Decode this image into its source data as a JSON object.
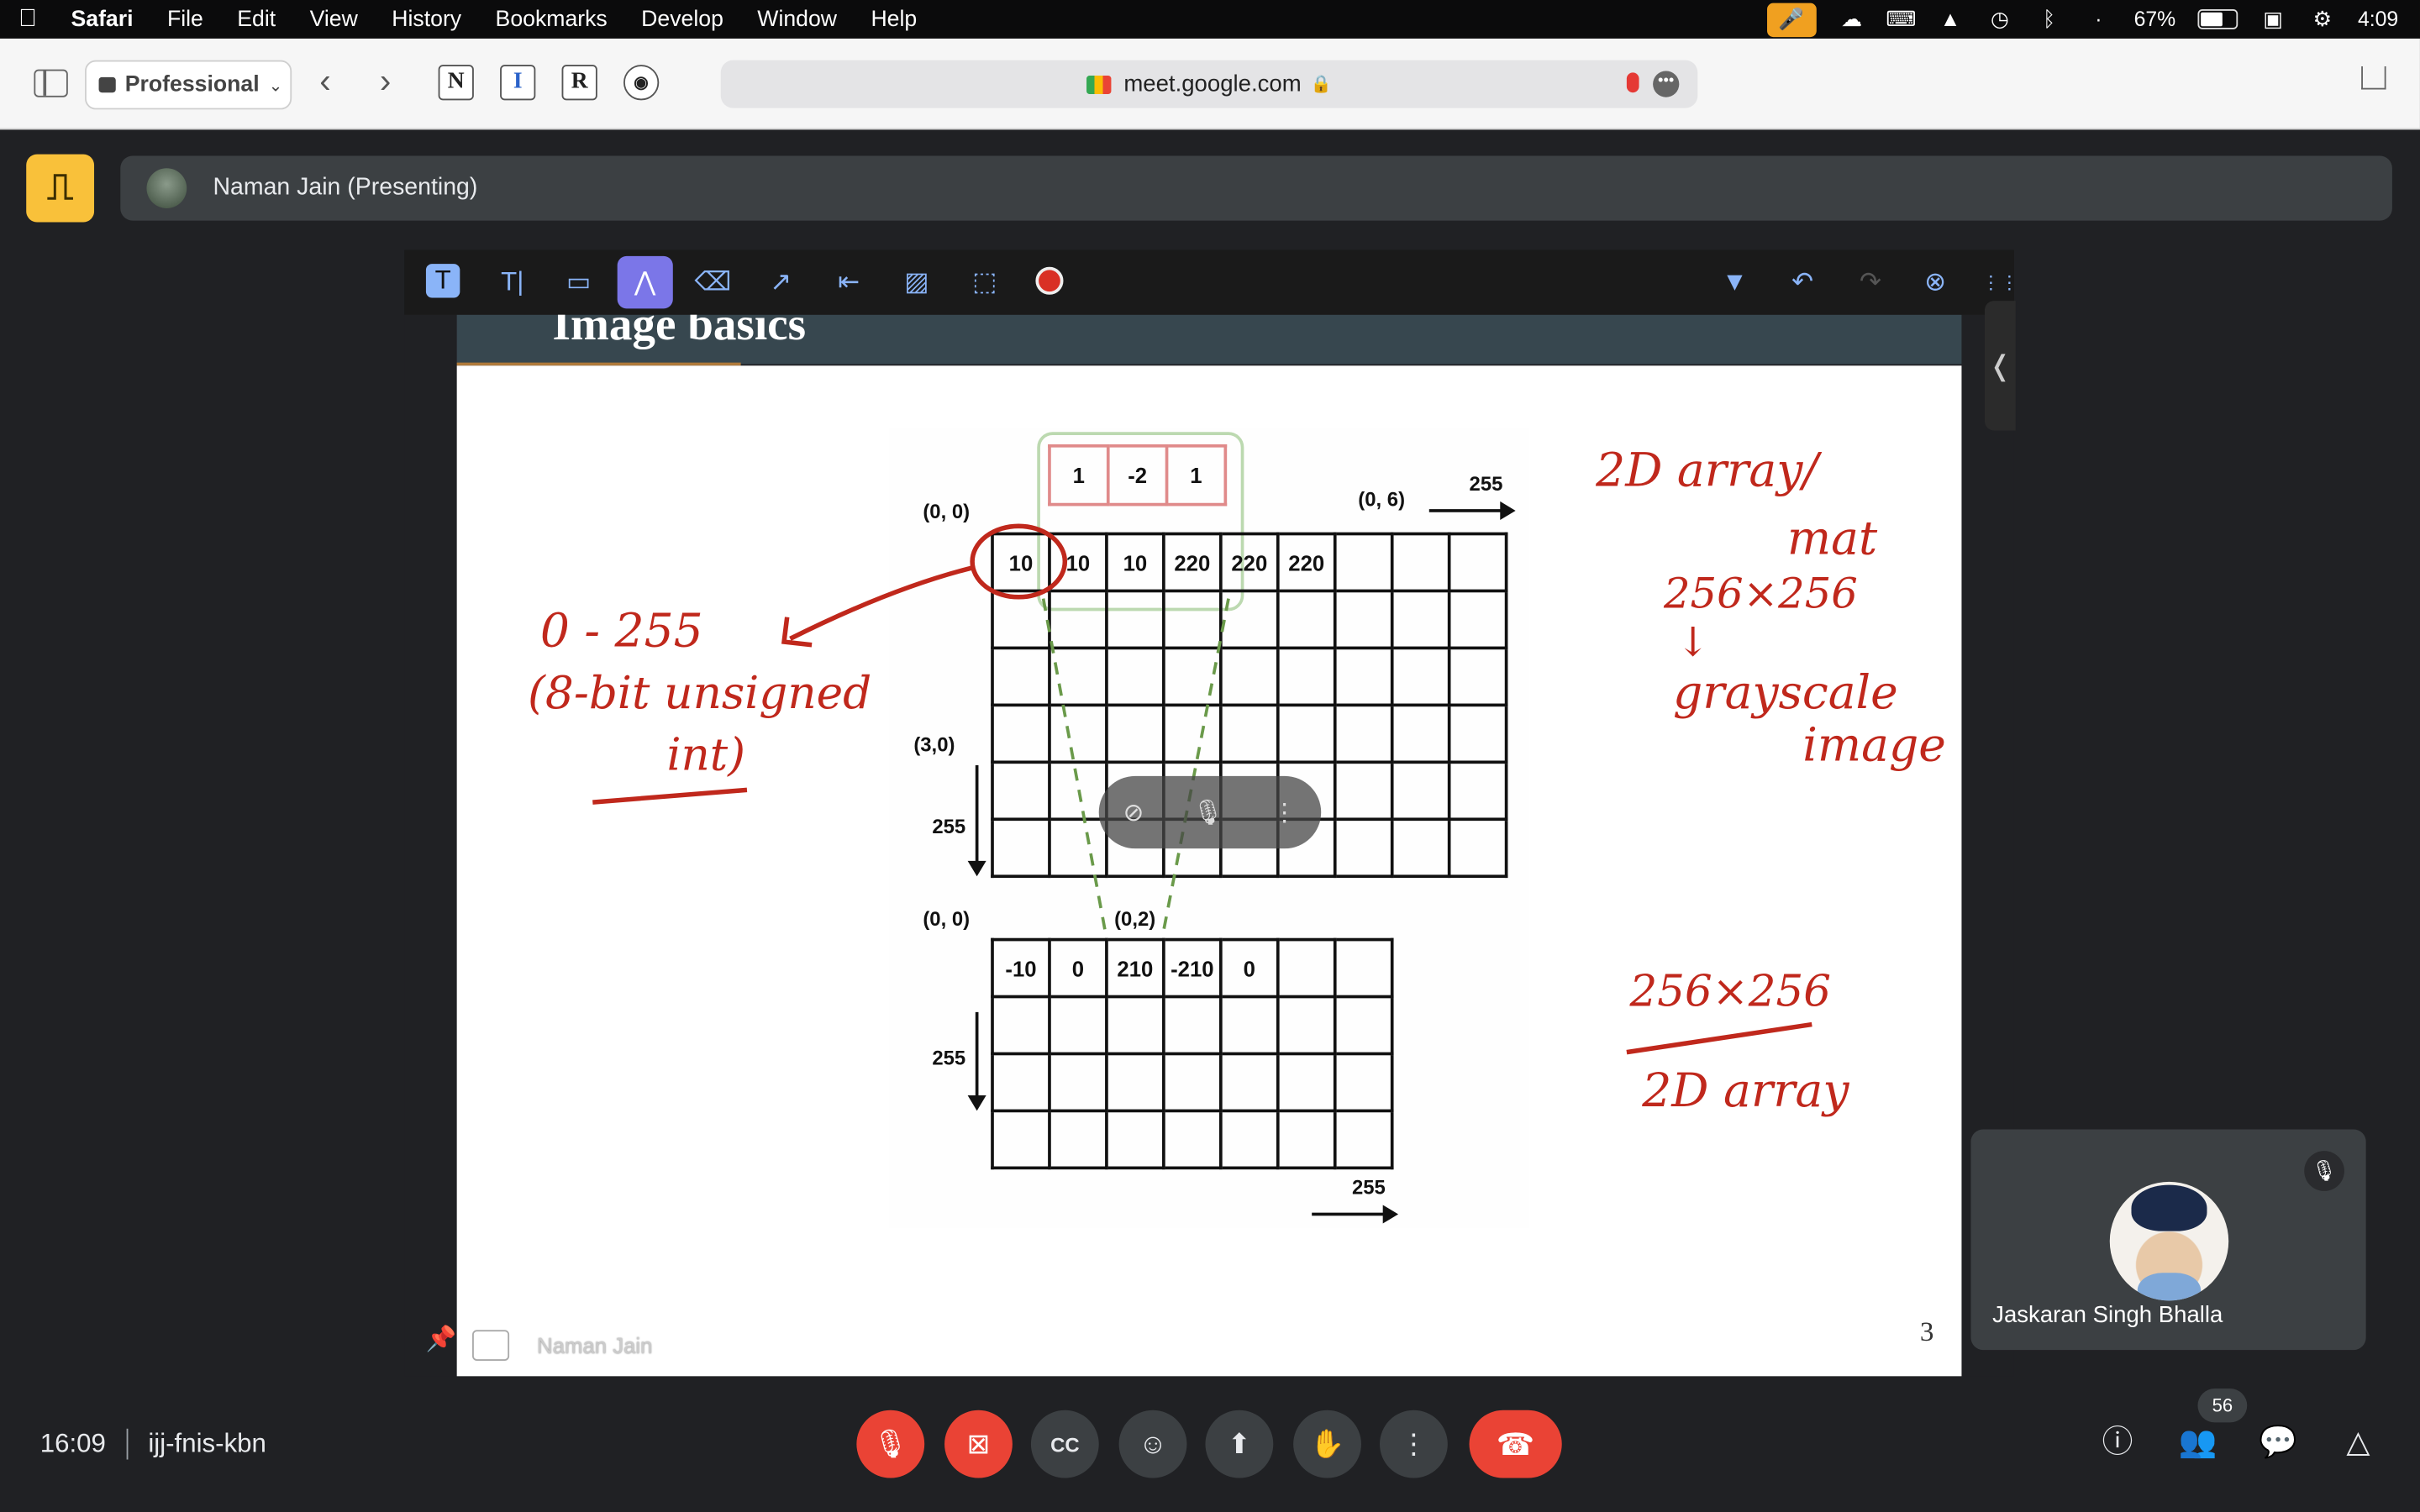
{
  "menubar": {
    "app": "Safari",
    "items": [
      "File",
      "Edit",
      "View",
      "History",
      "Bookmarks",
      "Develop",
      "Window",
      "Help"
    ],
    "battery": "67%",
    "time": "4:09"
  },
  "toolbar": {
    "profile": "Professional",
    "url": "meet.google.com",
    "extensions": [
      "N",
      "I",
      "R"
    ]
  },
  "meet": {
    "presenter": "Naman Jain (Presenting)",
    "slide_title": "Image basics",
    "page_number": "3",
    "footer_name": "Naman Jain",
    "participant": "Jaskaran Singh Bhalla",
    "clock": "16:09",
    "meeting_code": "ijj-fnis-kbn",
    "participant_count": "56"
  },
  "diagram": {
    "kernel": [
      "1",
      "-2",
      "1"
    ],
    "top_row": [
      "10",
      "10",
      "10",
      "220",
      "220",
      "220",
      "",
      "",
      ""
    ],
    "bottom_row": [
      "-10",
      "0",
      "210",
      "-210",
      "0",
      "",
      ""
    ],
    "labels": {
      "origin_top": "(0, 0)",
      "col6": "(0, 6)",
      "top_255": "255",
      "row3": "(3,0)",
      "left_255": "255",
      "origin_bottom": "(0, 0)",
      "col2": "(0,2)",
      "left_255_b": "255",
      "bottom_255": "255"
    }
  },
  "annotations": {
    "range": "0 - 255",
    "range_note_1": "(8-bit unsigned",
    "range_note_2": "int)",
    "right_1": "2D  array/",
    "right_2": "mat",
    "right_3": "256×256",
    "right_4": "grayscale",
    "right_5": "image",
    "right_6": "256×256",
    "right_7": "2D array"
  },
  "colors": {
    "ink": "#c0281c",
    "accent": "#7b76e8",
    "end_call": "#ea4335",
    "leave_badge": "#f9c13a"
  }
}
